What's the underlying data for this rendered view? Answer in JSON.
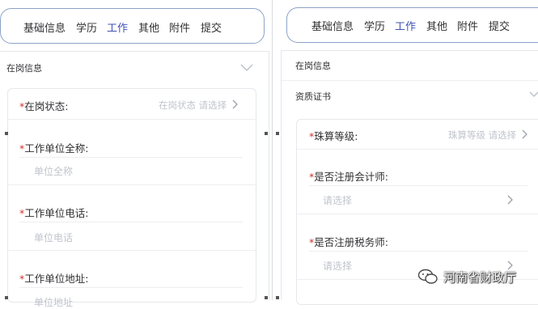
{
  "left": {
    "tabs": [
      {
        "label": "基础信息",
        "active": false
      },
      {
        "label": "学历",
        "active": false
      },
      {
        "label": "工作",
        "active": true
      },
      {
        "label": "其他",
        "active": false
      },
      {
        "label": "附件",
        "active": false
      },
      {
        "label": "提交",
        "active": false
      }
    ],
    "section_title": "在岗信息",
    "status_row": {
      "required": "*",
      "label": "在岗状态:",
      "hint": "在岗状态 请选择"
    },
    "fields": [
      {
        "required": "*",
        "label": "工作单位全称:",
        "placeholder": "单位全称"
      },
      {
        "required": "*",
        "label": "工作单位电话:",
        "placeholder": "单位电话"
      },
      {
        "required": "*",
        "label": "工作单位地址:",
        "placeholder": "单位地址"
      }
    ]
  },
  "right": {
    "tabs": [
      {
        "label": "基础信息",
        "active": false
      },
      {
        "label": "学历",
        "active": false
      },
      {
        "label": "工作",
        "active": true
      },
      {
        "label": "其他",
        "active": false
      },
      {
        "label": "附件",
        "active": false
      },
      {
        "label": "提交",
        "active": false
      }
    ],
    "section_title": "在岗信息",
    "cert_title": "资质证书",
    "abacus_row": {
      "required": "*",
      "label": "珠算等级:",
      "hint": "珠算等级 请选择"
    },
    "fields": [
      {
        "required": "*",
        "label": "是否注册会计师:",
        "placeholder": "请选择"
      },
      {
        "required": "*",
        "label": "是否注册税务师:",
        "placeholder": "请选择"
      }
    ]
  },
  "watermark": {
    "text": "河南省财政厅",
    "icon": "wechat-icon"
  },
  "colors": {
    "accent": "#3f51b5",
    "required": "#d32f2f",
    "placeholder": "#c0c4cc",
    "tab_border": "#8da2c7"
  }
}
